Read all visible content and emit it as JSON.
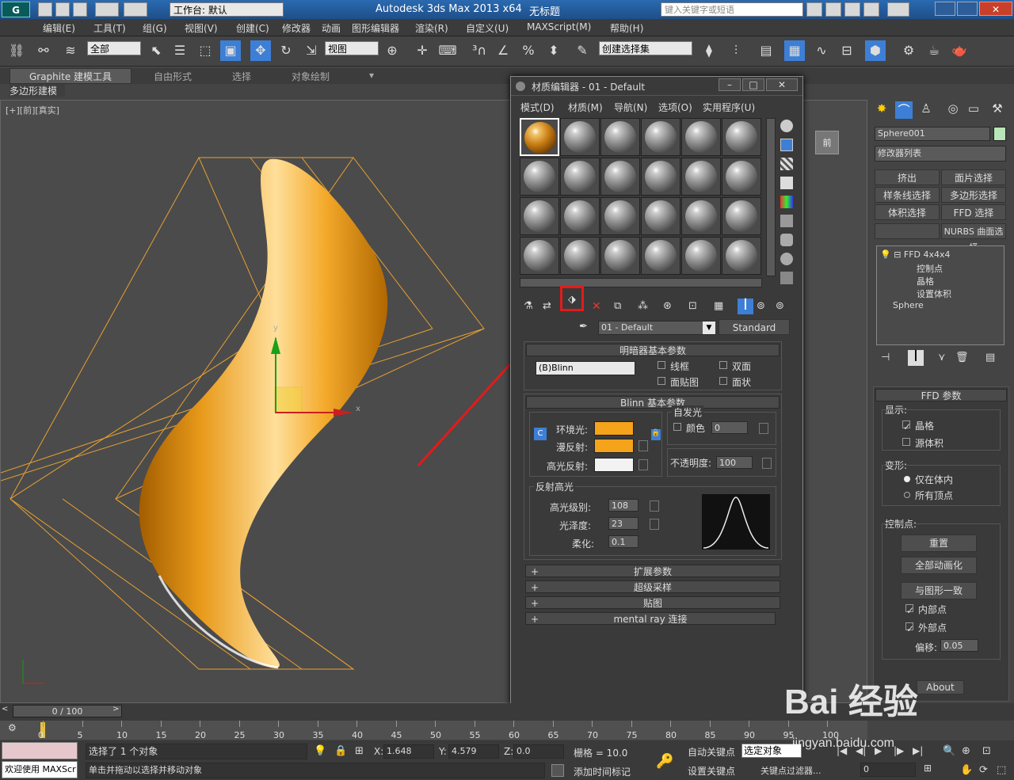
{
  "app": {
    "title": "Autodesk 3ds Max  2013 x64",
    "doc": "无标题",
    "workspace": "工作台: 默认",
    "create_dropdown": "创建",
    "search_placeholder": "键入关键字或短语"
  },
  "menubar": [
    "编辑(E)",
    "工具(T)",
    "组(G)",
    "视图(V)",
    "创建(C)",
    "修改器",
    "动画",
    "图形编辑器",
    "渲染(R)",
    "自定义(U)",
    "MAXScript(M)",
    "帮助(H)"
  ],
  "toolbar": {
    "selection_filter": "全部",
    "ref_coord": "视图",
    "named_selection": "创建选择集"
  },
  "ribbon": {
    "tabs": [
      "Graphite 建模工具",
      "自由形式",
      "选择",
      "对象绘制"
    ],
    "sub": "多边形建模"
  },
  "viewport": {
    "label": "[+][前][真实]",
    "cube_label": "前",
    "axis_y": "y",
    "axis_x": "x"
  },
  "material_editor": {
    "title": "材质编辑器 - 01 - Default",
    "menu": [
      "模式(D)",
      "材质(M)",
      "导航(N)",
      "选项(O)",
      "实用程序(U)"
    ],
    "material_name": "01 - Default",
    "material_type": "Standard",
    "shader_rollout": "明暗器基本参数",
    "shader": "(B)Blinn",
    "shader_checks": [
      "线框",
      "双面",
      "面贴图",
      "面状"
    ],
    "blinn_rollout": "Blinn 基本参数",
    "self_illum": "自发光",
    "color_label": "颜色",
    "color_value": "0",
    "ambient": "环境光:",
    "diffuse": "漫反射:",
    "specular": "高光反射:",
    "opacity_label": "不透明度:",
    "opacity": "100",
    "spec_highlights": "反射高光",
    "spec_level_label": "高光级别:",
    "spec_level": "108",
    "glossiness_label": "光泽度:",
    "glossiness": "23",
    "soften_label": "柔化:",
    "soften": "0.1",
    "ambient_color": "#f5a31a",
    "diffuse_color": "#f5a31a",
    "specular_color": "#f2f2f2",
    "collapsed": [
      "扩展参数",
      "超级采样",
      "贴图",
      "mental ray 连接"
    ]
  },
  "command_panel": {
    "object_name": "Sphere001",
    "modifier_list": "修改器列表",
    "buttons": [
      "挤出",
      "面片选择",
      "样条线选择",
      "多边形选择",
      "体积选择",
      "FFD 选择",
      "",
      "NURBS 曲面选择"
    ],
    "stack": [
      "FFD 4x4x4",
      "控制点",
      "晶格",
      "设置体积",
      "Sphere"
    ],
    "ffd_rollout": "FFD 参数",
    "display": "显示:",
    "display_opts": [
      "晶格",
      "源体积"
    ],
    "deform": "变形:",
    "deform_opts": [
      "仅在体内",
      "所有顶点"
    ],
    "control_points": "控制点:",
    "cp_buttons": [
      "重置",
      "全部动画化",
      "与图形一致"
    ],
    "cp_checks": [
      "内部点",
      "外部点"
    ],
    "offset_label": "偏移:",
    "offset": "0.05",
    "about": "About"
  },
  "timeline": {
    "frame": "0 / 100",
    "ticks": [
      "0",
      "5",
      "10",
      "15",
      "20",
      "25",
      "30",
      "35",
      "40",
      "45",
      "50",
      "55",
      "60",
      "65",
      "70",
      "75",
      "80",
      "85",
      "90",
      "95",
      "100"
    ]
  },
  "status": {
    "welcome": "欢迎使用 MAXScr",
    "selected": "选择了 1 个对象",
    "prompt": "单击并拖动以选择并移动对象",
    "x_label": "X:",
    "x": "1.648",
    "y_label": "Y:",
    "y": "4.579",
    "z_label": "Z:",
    "z": "0.0",
    "grid": "栅格 = 10.0",
    "add_time_tag": "添加时间标记",
    "auto_key": "自动关键点",
    "selected_obj": "选定对象",
    "set_key": "设置关键点",
    "key_filters": "关键点过滤器...",
    "frame_field": "0"
  },
  "watermark": "Bai 经验",
  "watermark_url": "jingyan.baidu.com"
}
